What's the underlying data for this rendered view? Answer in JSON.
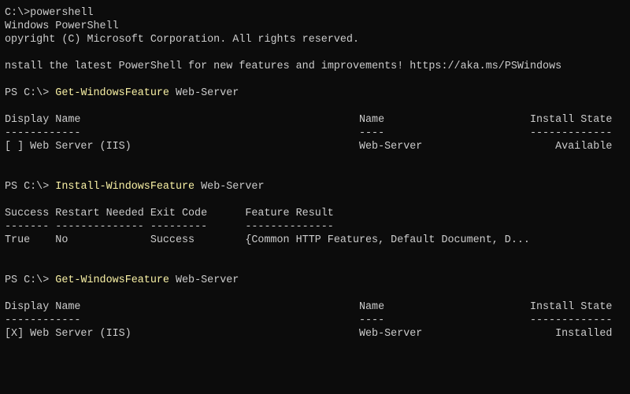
{
  "terminal": {
    "colors": {
      "background": "#0c0c0c",
      "text": "#cccccc",
      "command": "#f9f1a5"
    },
    "intro": [
      "C:\\>powershell",
      "Windows PowerShell",
      "opyright (C) Microsoft Corporation. All rights reserved.",
      "nstall the latest PowerShell for new features and improvements! https://aka.ms/PSWindows"
    ],
    "prompt": "PS C:\\> ",
    "commands": [
      {
        "cmdlet": "Get-WindowsFeature",
        "arg": " Web-Server"
      },
      {
        "cmdlet": "Install-WindowsFeature",
        "arg": " Web-Server"
      },
      {
        "cmdlet": "Get-WindowsFeature",
        "arg": " Web-Server"
      }
    ],
    "feature_table": {
      "headers": [
        "Display Name",
        "Name",
        "Install State"
      ],
      "dashes": [
        "------------",
        "----",
        "-------------"
      ],
      "before": [
        "[ ] Web Server (IIS)",
        "Web-Server",
        "Available"
      ],
      "after": [
        "[X] Web Server (IIS)",
        "Web-Server",
        "Installed"
      ]
    },
    "install_table": {
      "headers": [
        "Success",
        "Restart Needed",
        "Exit Code",
        "Feature Result"
      ],
      "dashes": [
        "-------",
        "--------------",
        "---------",
        "--------------"
      ],
      "row": [
        "True",
        "No",
        "Success",
        "{Common HTTP Features, Default Document, D..."
      ]
    }
  }
}
